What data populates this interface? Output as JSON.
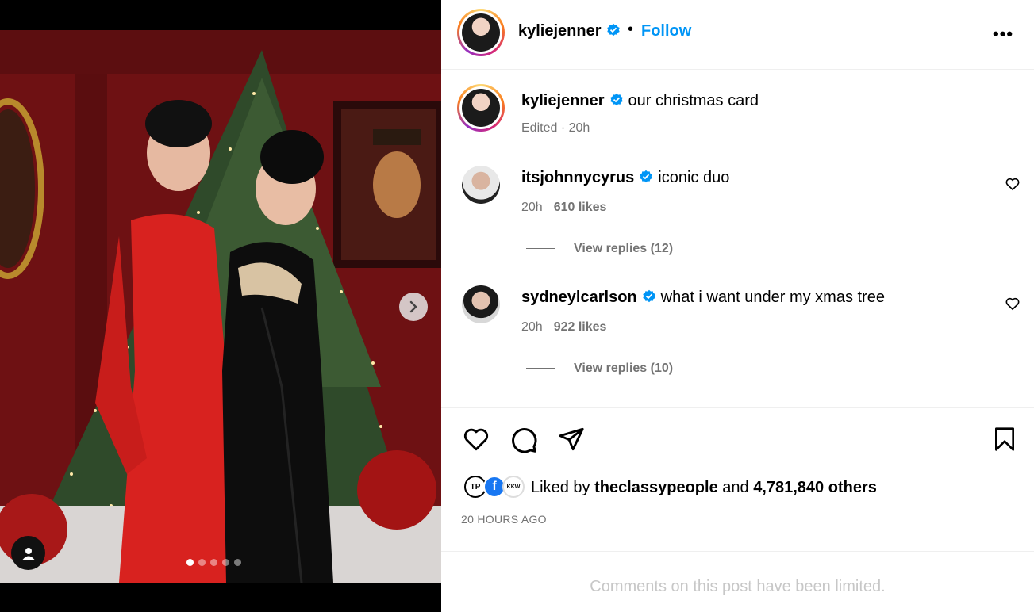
{
  "post": {
    "username": "kyliejenner",
    "follow_label": "Follow",
    "separator": "•",
    "more_label": "•••",
    "caption": "our christmas card",
    "caption_meta": "Edited · 20h",
    "media_dots": 5,
    "active_dot": 0
  },
  "comments": [
    {
      "username": "itsjohnnycyrus",
      "text": "iconic duo",
      "time": "20h",
      "likes": "610 likes",
      "replies": "View replies (12)"
    },
    {
      "username": "sydneylcarlson",
      "text": "what i want under my xmas tree",
      "time": "20h",
      "likes": "922 likes",
      "replies": "View replies (10)"
    }
  ],
  "likes": {
    "prefix": "Liked by",
    "user": "theclassypeople",
    "and": "and",
    "others": "4,781,840 others",
    "mini_avatars": [
      "TP",
      "f",
      "KKW"
    ]
  },
  "timestamp": "20 HOURS AGO",
  "footer": "Comments on this post have been limited.",
  "icons": [
    "heart-icon",
    "comment-icon",
    "share-icon",
    "bookmark-icon",
    "chevron-right-icon",
    "user-tag-icon",
    "verified-icon"
  ],
  "colors": {
    "accent": "#0095f6",
    "muted": "#737373",
    "verified": "#0095f6",
    "limited_text": "#c7c7c7"
  }
}
